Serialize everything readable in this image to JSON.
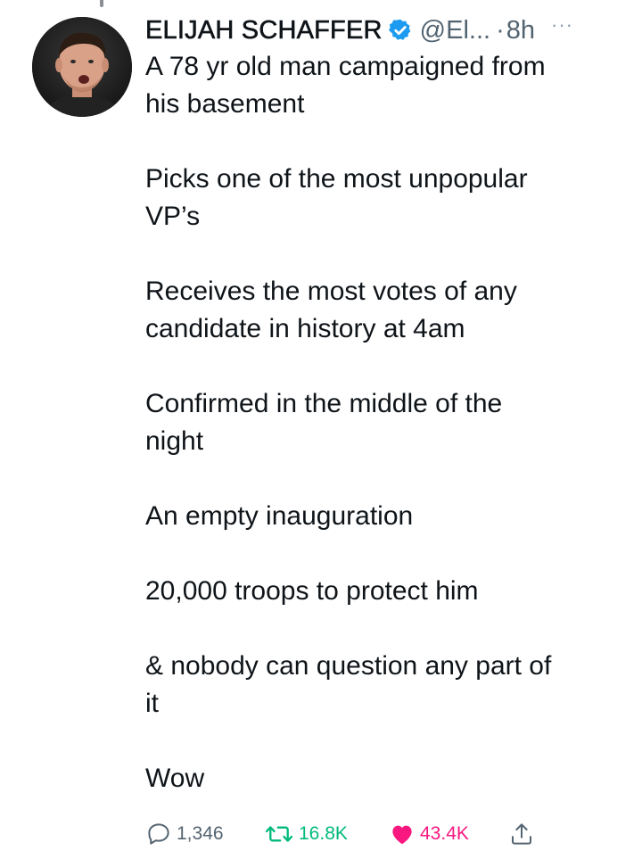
{
  "tweet": {
    "author_name": "ELIJAH SCHAFFER",
    "handle": "@El...",
    "separator": "·",
    "time": "8h",
    "more": "···",
    "paragraphs": [
      "A 78 yr old man campaigned from\nhis basement",
      "Picks one of the most unpopular\nVP’s",
      "Receives the most votes of any\ncandidate in history at 4am",
      "Confirmed in the middle of the\nnight",
      "An empty inauguration",
      "20,000 troops to protect him",
      "& nobody can question any part of\nit",
      "Wow"
    ]
  },
  "actions": {
    "reply_count": "1,346",
    "retweet_count": "16.8K",
    "like_count": "43.4K"
  },
  "colors": {
    "text": "#0f1419",
    "secondary": "#536471",
    "verified": "#1d9bf0",
    "retweet": "#00ba7c",
    "like": "#f91880"
  },
  "icons": [
    "verified-badge-icon",
    "more-icon",
    "reply-icon",
    "retweet-icon",
    "like-icon",
    "share-icon"
  ]
}
